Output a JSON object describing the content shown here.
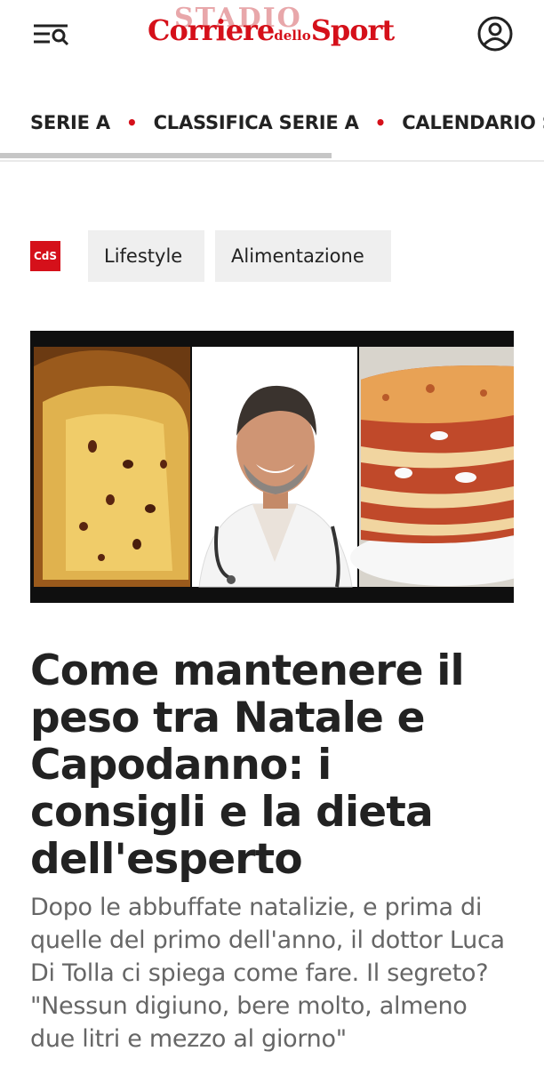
{
  "header": {
    "logo_watermark": "STADIO",
    "logo_part1": "Corriere",
    "logo_part2": "dello",
    "logo_part3": "Sport",
    "menu_icon": "menu-search-icon",
    "user_icon": "user-icon"
  },
  "nav": {
    "items": [
      "SERIE A",
      "CLASSIFICA SERIE A",
      "CALENDARIO SERIE A"
    ],
    "separator_color": "#d5101a"
  },
  "tags": {
    "badge": "CdS",
    "items": [
      "Lifestyle",
      "Alimentazione"
    ]
  },
  "article": {
    "title": "Come mantenere il peso tra Natale e Capodanno: i consigli e la dieta dell'esperto",
    "summary": "Dopo le abbuffate natalizie, e prima di quelle del primo dell'anno, il dottor Luca Di Tolla ci spiega come fare. Il segreto? \"Nessun digiuno, bere molto, almeno due litri e mezzo al giorno\""
  },
  "colors": {
    "brand": "#d5101a",
    "text": "#222222",
    "muted": "#666666",
    "tag_bg": "#efefef"
  }
}
